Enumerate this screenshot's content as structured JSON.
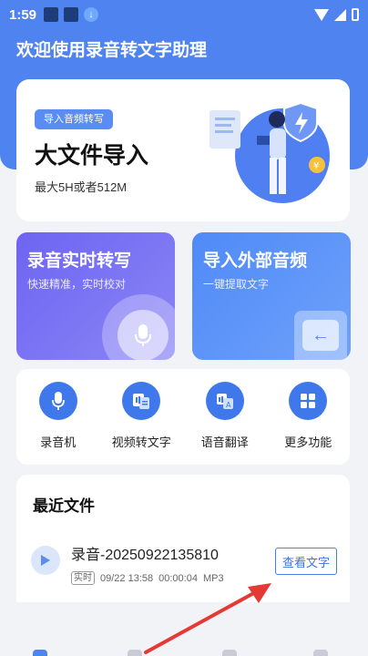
{
  "status_bar": {
    "time": "1:59"
  },
  "app": {
    "title": "欢迎使用录音转文字助理"
  },
  "hero": {
    "tag": "导入音频转写",
    "title": "大文件导入",
    "subtitle": "最大5H或者512M"
  },
  "cards": {
    "record": {
      "title": "录音实时转写",
      "subtitle": "快速精准，实时校对"
    },
    "import": {
      "title": "导入外部音频",
      "subtitle": "一键提取文字"
    }
  },
  "tools": [
    {
      "label": "录音机",
      "icon": "microphone-icon"
    },
    {
      "label": "视频转文字",
      "icon": "video-to-text-icon"
    },
    {
      "label": "语音翻译",
      "icon": "translate-icon"
    },
    {
      "label": "更多功能",
      "icon": "grid-icon"
    }
  ],
  "recent": {
    "title": "最近文件",
    "files": [
      {
        "name": "录音-20250922135810",
        "tag": "实时",
        "date": "09/22 13:58",
        "duration": "00:00:04",
        "format": "MP3",
        "action": "查看文字"
      }
    ]
  },
  "colors": {
    "primary": "#4f83f0",
    "record_card": "#6e64f2",
    "import_card": "#4f8af7",
    "accent_red": "#e53935"
  }
}
